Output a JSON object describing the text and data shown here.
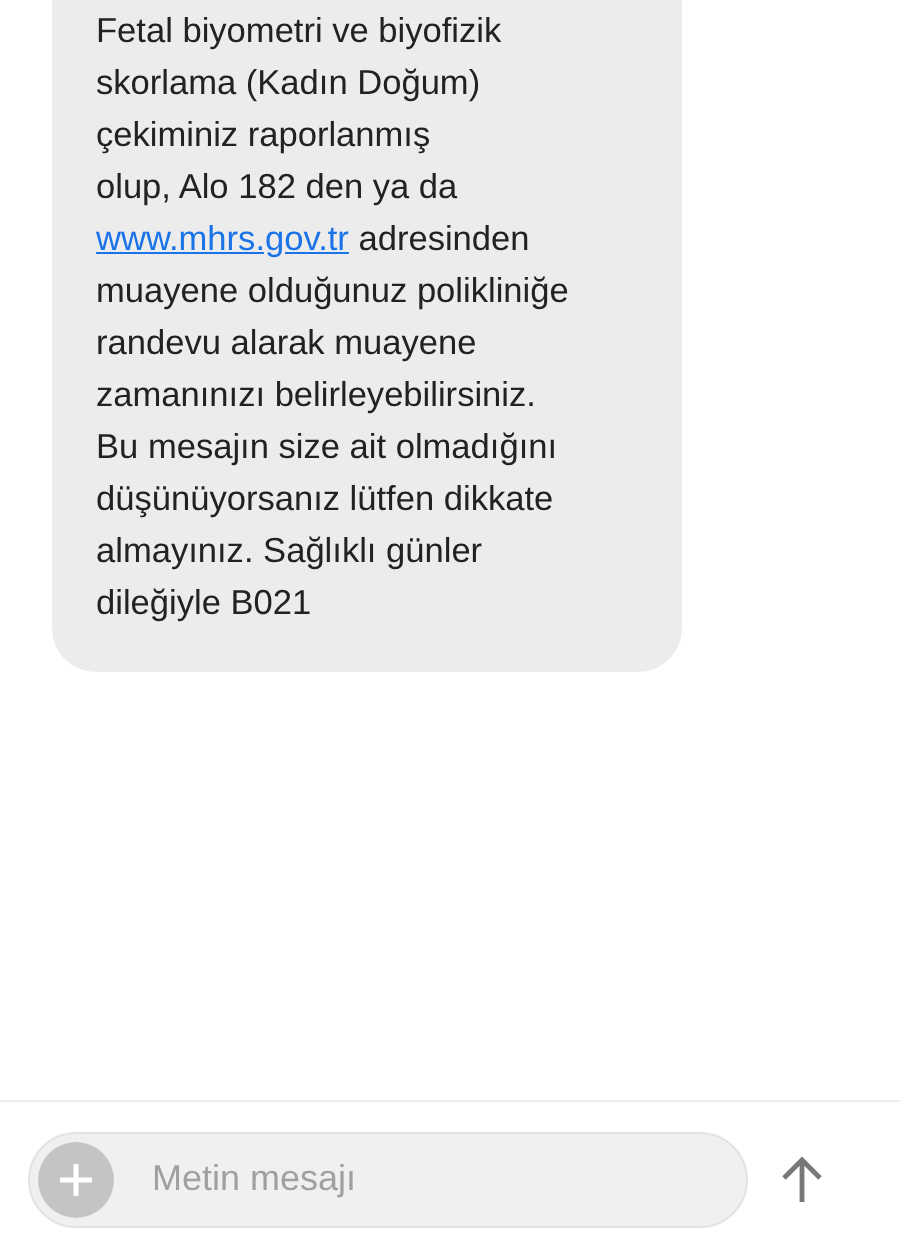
{
  "message": {
    "text_before": "Fetal biyometri ve biyofizik\nskorlama (Kadın Doğum)\nçekiminiz raporlanmış\nolup, Alo 182 den ya da\n",
    "link": "www.mhrs.gov.tr",
    "text_after": " adresinden\nmuayene olduğunuz polikliniğe\nrandevu alarak muayene\nzamanınızı belirleyebilirsiniz.\nBu mesajın size ait olmadığını\ndüşünüyorsanız lütfen dikkate\nalmayınız. Sağlıklı günler\ndileğiyle B021"
  },
  "composer": {
    "placeholder": "Metin mesajı"
  }
}
